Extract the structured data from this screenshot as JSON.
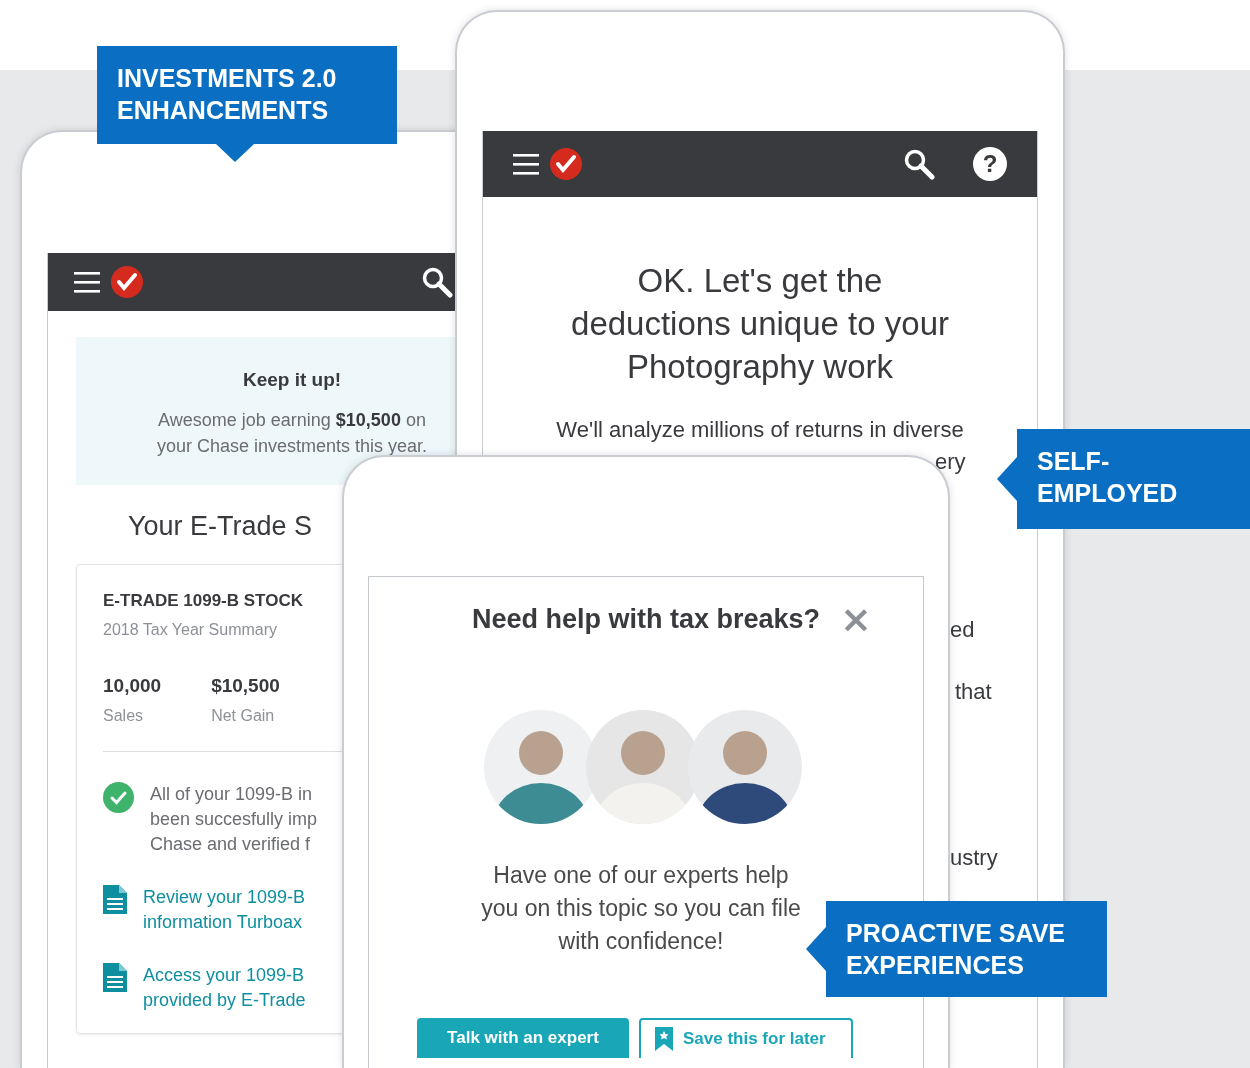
{
  "callouts": [
    {
      "text": "INVESTMENTS 2.0 ENHANCEMENTS",
      "kind": "down"
    },
    {
      "text": "SELF-EMPLOYED",
      "kind": "left"
    },
    {
      "text": "PROACTIVE SAVE EXPERIENCES",
      "kind": "left"
    }
  ],
  "investments_screen": {
    "banner": {
      "title": "Keep it up!",
      "text": "Awesome job earning **$10,500** on your Chase investments this year."
    },
    "section_title": "Your E-Trade S",
    "card": {
      "title": "E-TRADE 1099-B STOCK",
      "subtitle": "2018 Tax Year Summary",
      "stats": [
        {
          "value": "10,000",
          "label": "Sales"
        },
        {
          "value": "$10,500",
          "label": "Net Gain"
        }
      ],
      "items": [
        {
          "kind": "status",
          "lines": [
            "All of your 1099-B in",
            "been succesfully imp",
            "Chase and verified f"
          ]
        },
        {
          "kind": "link",
          "lines": [
            "Review your 1099-B",
            "information Turboax"
          ]
        },
        {
          "kind": "link",
          "lines": [
            "Access your 1099-B",
            "provided by E-Trade"
          ]
        }
      ]
    }
  },
  "deductions_screen": {
    "nav": {
      "help": "?"
    },
    "heading": [
      "OK. Let's get the",
      "deductions unique to your",
      "Photography work"
    ],
    "paragraph": "We'll analyze millions of returns in diverse",
    "fragments": [
      "ery",
      "ed",
      "that",
      "ustry"
    ]
  },
  "help_modal": {
    "title": "Need help with tax breaks?",
    "close": "×",
    "text": [
      "Have one of our experts help",
      "you on this topic so you can file",
      "with confidence!"
    ],
    "buttons": [
      {
        "kind": "primary",
        "label": "Talk with an expert"
      },
      {
        "kind": "secondary",
        "label": "Save this for later"
      }
    ]
  }
}
